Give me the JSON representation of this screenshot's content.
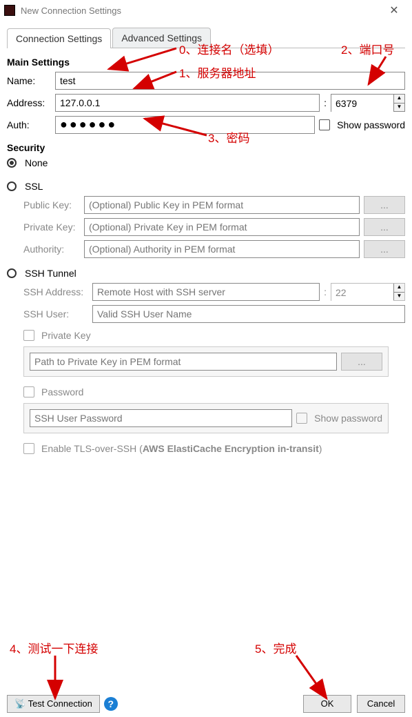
{
  "window": {
    "title": "New Connection Settings",
    "close_glyph": "✕"
  },
  "tabs": {
    "connection": "Connection Settings",
    "advanced": "Advanced Settings"
  },
  "main": {
    "heading": "Main Settings",
    "name_label": "Name:",
    "name_value": "test",
    "address_label": "Address:",
    "address_value": "127.0.0.1",
    "port_sep": ":",
    "port_value": "6379",
    "auth_label": "Auth:",
    "auth_value": "●●●●●●",
    "show_password_label": "Show password"
  },
  "security": {
    "heading": "Security",
    "none_label": "None",
    "ssl_label": "SSL",
    "public_key_label": "Public Key:",
    "public_key_ph": "(Optional) Public Key in PEM format",
    "private_key_label": "Private Key:",
    "private_key_ph": "(Optional) Private Key in PEM format",
    "authority_label": "Authority:",
    "authority_ph": "(Optional) Authority in PEM format",
    "browse_label": "...",
    "ssh_tunnel_label": "SSH Tunnel",
    "ssh_address_label": "SSH Address:",
    "ssh_address_ph": "Remote Host with SSH server",
    "ssh_port_value": "22",
    "ssh_user_label": "SSH User:",
    "ssh_user_ph": "Valid SSH User Name",
    "ssh_private_key_label": "Private Key",
    "ssh_private_key_ph": "Path to Private Key in PEM format",
    "ssh_password_label": "Password",
    "ssh_password_ph": "SSH User Password",
    "ssh_show_password_label": "Show password",
    "tls_over_ssh_prefix": "Enable TLS-over-SSH (",
    "tls_over_ssh_bold": "AWS ElastiCache Encryption in-transit",
    "tls_over_ssh_suffix": ")"
  },
  "footer": {
    "test_connection": "Test Connection",
    "help_glyph": "?",
    "ok": "OK",
    "cancel": "Cancel",
    "test_icon": "📡"
  },
  "annotations": {
    "a0": "0、连接名（选填）",
    "a1": "1、服务器地址",
    "a2": "2、端口号",
    "a3": "3、密码",
    "a4": "4、测试一下连接",
    "a5": "5、完成"
  }
}
